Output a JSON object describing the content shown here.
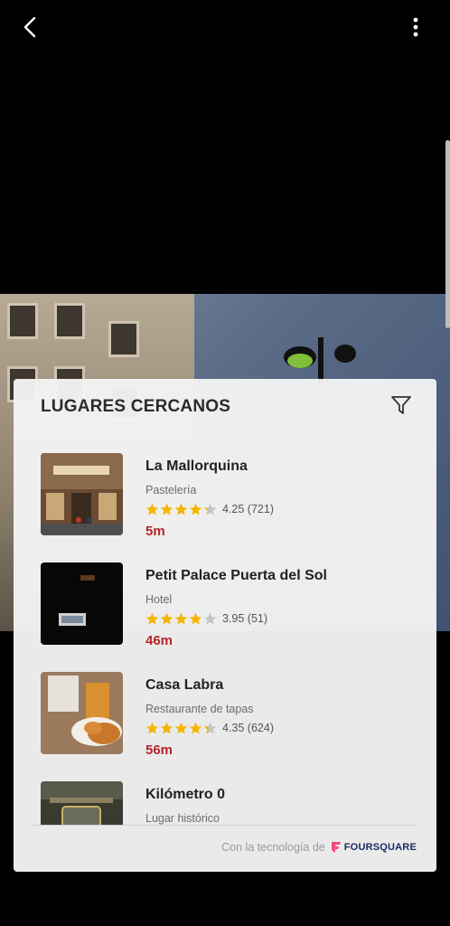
{
  "colors": {
    "accent_distance": "#b3262a",
    "star_filled": "#f4b400",
    "star_empty": "#c4c4c4",
    "foursquare_brand": "#f94877",
    "foursquare_text": "#1c2b66"
  },
  "panel": {
    "title": "LUGARES CERCANOS"
  },
  "places": [
    {
      "name": "La Mallorquina",
      "category": "Pastelería",
      "rating": 4.25,
      "rating_text": "4.25 (721)",
      "distance": "5m"
    },
    {
      "name": "Petit Palace Puerta del Sol",
      "category": "Hotel",
      "rating": 3.95,
      "rating_text": "3.95 (51)",
      "distance": "46m"
    },
    {
      "name": "Casa Labra",
      "category": "Restaurante de tapas",
      "rating": 4.35,
      "rating_text": "4.35 (624)",
      "distance": "56m"
    },
    {
      "name": "Kilómetro 0",
      "category": "Lugar histórico"
    }
  ],
  "footer": {
    "powered_by": "Con la tecnología de",
    "brand": "FOURSQUARE"
  },
  "icons": {
    "back": "back-arrow-icon",
    "more": "more-vert-icon",
    "filter": "filter-icon",
    "star": "star-icon",
    "foursquare": "foursquare-logo-icon"
  }
}
